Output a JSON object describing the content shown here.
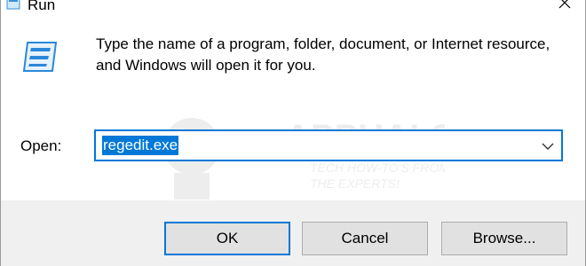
{
  "window": {
    "title": "Run",
    "close_glyph": "✕"
  },
  "icons": {
    "app": "run-app-icon",
    "run": "run-dialog-icon",
    "close": "close-icon",
    "dropdown": "chevron-down-icon"
  },
  "message": "Type the name of a program, folder, document, or Internet resource, and Windows will open it for you.",
  "open": {
    "label": "Open:",
    "value": "regedit.exe"
  },
  "buttons": {
    "ok": "OK",
    "cancel": "Cancel",
    "browse": "Browse..."
  },
  "watermark": {
    "brand": "APPUALS",
    "tagline_line1": "TECH HOW-TO'S FROM",
    "tagline_line2": "THE EXPERTS!"
  },
  "colors": {
    "accent": "#0078d7",
    "footer_bg": "#f0f0f0",
    "button_bg": "#e1e1e1"
  }
}
